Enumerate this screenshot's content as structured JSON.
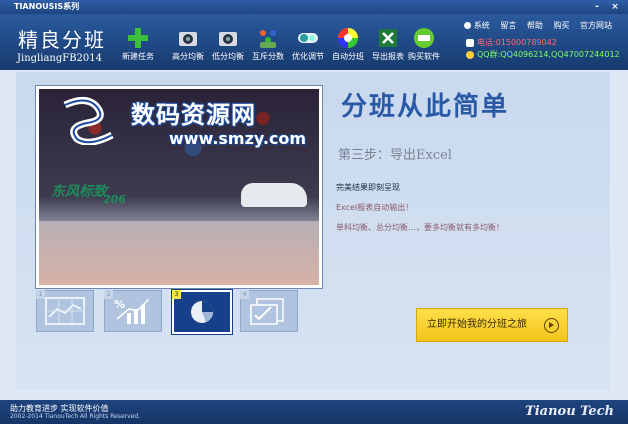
{
  "window": {
    "title": "TIANOUSIS系列",
    "min": "-",
    "close": "×"
  },
  "brand": {
    "cn": "精良分班",
    "en": "JingliangFB2014"
  },
  "toolbar": [
    {
      "label": "新建任务",
      "icon": "plus-icon"
    },
    {
      "label": "高分均衡",
      "icon": "camera-icon"
    },
    {
      "label": "低分均衡",
      "icon": "camera-icon"
    },
    {
      "label": "互斥分数",
      "icon": "people-icon"
    },
    {
      "label": "优化调节",
      "icon": "toggle-icon"
    },
    {
      "label": "自动分班",
      "icon": "color-wheel-icon"
    },
    {
      "label": "导出报表",
      "icon": "excel-icon"
    },
    {
      "label": "购买软件",
      "icon": "cart-icon"
    }
  ],
  "sysmenu": [
    "系统",
    "留言",
    "帮助",
    "购买",
    "官方网站"
  ],
  "contact": {
    "phone": "电话:015000789042",
    "qq": "QQ群:QQ4096214,QQ47007244012"
  },
  "watermark": {
    "name": "数码资源网",
    "url": "www.smzy.com"
  },
  "photo_signs": {
    "sign1": "东风标致",
    "sign2": "206"
  },
  "main": {
    "title": "分班从此简单",
    "step": "第三步：导出Excel",
    "desc1": "完美结果即刻呈现",
    "desc2": "Excel报表自动输出！",
    "desc3": "单科均衡、总分均衡…，要多均衡就有多均衡！"
  },
  "thumbs": [
    {
      "num": "1",
      "icon": "line-chart-icon"
    },
    {
      "num": "2",
      "icon": "percent-chart-icon"
    },
    {
      "num": "3",
      "icon": "pie-chart-icon"
    },
    {
      "num": "4",
      "icon": "checkbox-icon"
    }
  ],
  "start_button": "立即开始我的分班之旅",
  "footer": {
    "slogan": "助力教育进步   实现软件价值",
    "copyright": "2002-2014 TianouTech All Rights Reserved.",
    "company": "Tianou Tech"
  },
  "colors": {
    "accent": "#2a5aa6",
    "button": "#f2c41b",
    "header": "#1e447f"
  }
}
